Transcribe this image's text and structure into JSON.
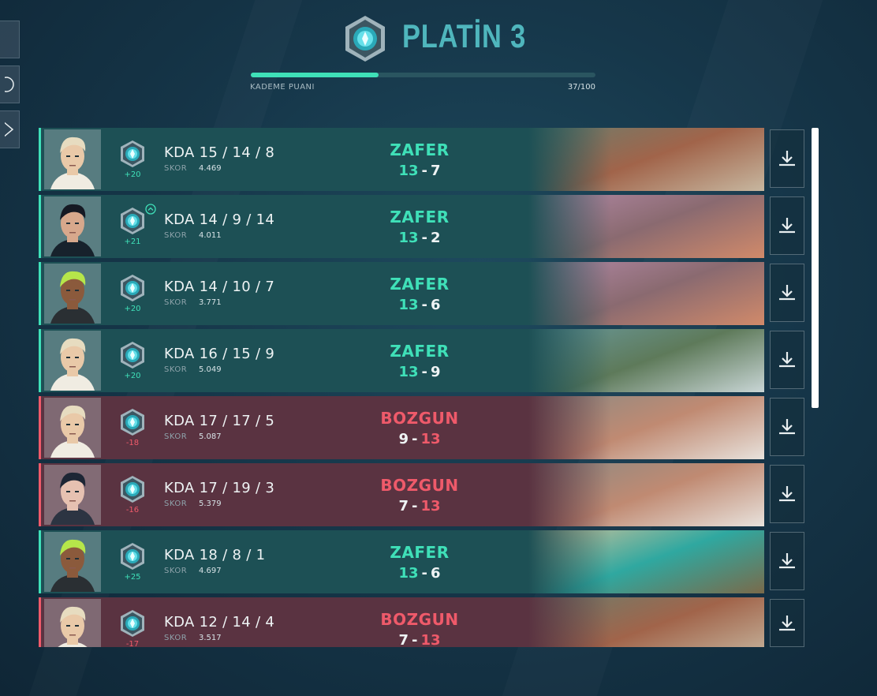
{
  "rank": {
    "name": "PLATİN 3",
    "progress_label": "KADEME PUANI",
    "progress_value": "37/100",
    "progress_fraction": 0.37
  },
  "skor_label": "SKOR",
  "matches": [
    {
      "outcome": "win",
      "kda": "KDA 15 / 14 / 8",
      "skor": "4.469",
      "rr": "+20",
      "result": "ZAFER",
      "score_left": "13",
      "score_right": "7",
      "agent": "agent-1",
      "map": "map-a",
      "promo": false
    },
    {
      "outcome": "win",
      "kda": "KDA 14 / 9 / 14",
      "skor": "4.011",
      "rr": "+21",
      "result": "ZAFER",
      "score_left": "13",
      "score_right": "2",
      "agent": "agent-2",
      "map": "map-b",
      "promo": true
    },
    {
      "outcome": "win",
      "kda": "KDA 14 / 10 / 7",
      "skor": "3.771",
      "rr": "+20",
      "result": "ZAFER",
      "score_left": "13",
      "score_right": "6",
      "agent": "agent-3",
      "map": "map-b",
      "promo": false
    },
    {
      "outcome": "win",
      "kda": "KDA 16 / 15 / 9",
      "skor": "5.049",
      "rr": "+20",
      "result": "ZAFER",
      "score_left": "13",
      "score_right": "9",
      "agent": "agent-1",
      "map": "map-c",
      "promo": false
    },
    {
      "outcome": "loss",
      "kda": "KDA 17 / 17 / 5",
      "skor": "5.087",
      "rr": "-18",
      "result": "BOZGUN",
      "score_left": "9",
      "score_right": "13",
      "agent": "agent-1",
      "map": "map-d",
      "promo": false
    },
    {
      "outcome": "loss",
      "kda": "KDA 17 / 19 / 3",
      "skor": "5.379",
      "rr": "-16",
      "result": "BOZGUN",
      "score_left": "7",
      "score_right": "13",
      "agent": "agent-4",
      "map": "map-d",
      "promo": false
    },
    {
      "outcome": "win",
      "kda": "KDA 18 / 8 / 1",
      "skor": "4.697",
      "rr": "+25",
      "result": "ZAFER",
      "score_left": "13",
      "score_right": "6",
      "agent": "agent-3",
      "map": "map-e",
      "promo": false
    },
    {
      "outcome": "loss",
      "kda": "KDA 12 / 14 / 4",
      "skor": "3.517",
      "rr": "-17",
      "result": "BOZGUN",
      "score_left": "7",
      "score_right": "13",
      "agent": "agent-1",
      "map": "map-a",
      "promo": false
    }
  ],
  "colors": {
    "win": "#3fe0b8",
    "loss": "#ef5a6a",
    "rank": "#4fb6bd"
  },
  "icons": {
    "download": "download-icon",
    "rank": "platinum-rank-icon",
    "promo": "promotion-chevron-icon"
  }
}
